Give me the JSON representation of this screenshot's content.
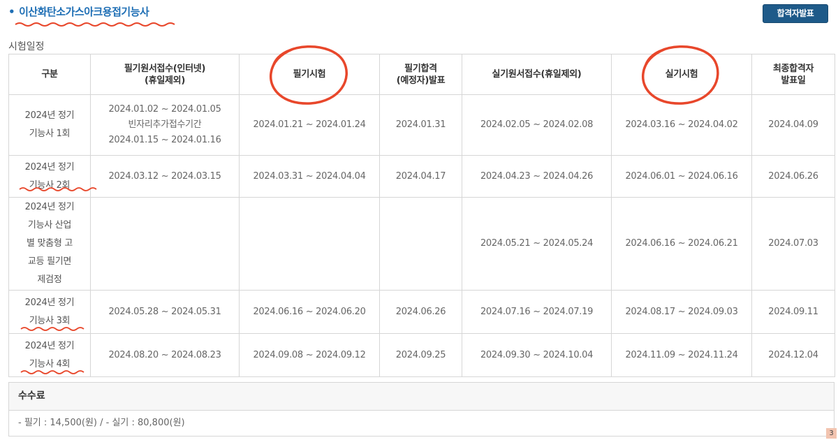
{
  "title": {
    "bullet": "•",
    "text": "이산화탄소가스아크용접기능사"
  },
  "result_button": "합격자발표",
  "section_label": "시험일정",
  "table": {
    "headers": [
      "구분",
      "필기원서접수(인터넷)\n(휴일제외)",
      "필기시험",
      "필기합격\n(예정자)발표",
      "실기원서접수(휴일제외)",
      "실기시험",
      "최종합격자\n발표일"
    ],
    "rows": [
      [
        "2024년 정기\n기능사 1회",
        "2024.01.02 ~ 2024.01.05\n빈자리추가접수기간\n2024.01.15 ~ 2024.01.16",
        "2024.01.21 ~ 2024.01.24",
        "2024.01.31",
        "2024.02.05 ~ 2024.02.08",
        "2024.03.16 ~ 2024.04.02",
        "2024.04.09"
      ],
      [
        "2024년 정기\n기능사 2회",
        "2024.03.12 ~ 2024.03.15",
        "2024.03.31 ~ 2024.04.04",
        "2024.04.17",
        "2024.04.23 ~ 2024.04.26",
        "2024.06.01 ~ 2024.06.16",
        "2024.06.26"
      ],
      [
        "2024년 정기\n기능사 산업\n별 맞춤형 고\n교등 필기면\n제검정",
        "",
        "",
        "",
        "2024.05.21 ~ 2024.05.24",
        "2024.06.16 ~ 2024.06.21",
        "2024.07.03"
      ],
      [
        "2024년 정기\n기능사 3회",
        "2024.05.28 ~ 2024.05.31",
        "2024.06.16 ~ 2024.06.20",
        "2024.06.26",
        "2024.07.16 ~ 2024.07.19",
        "2024.08.17 ~ 2024.09.03",
        "2024.09.11"
      ],
      [
        "2024년 정기\n기능사 4회",
        "2024.08.20 ~ 2024.08.23",
        "2024.09.08 ~ 2024.09.12",
        "2024.09.25",
        "2024.09.30 ~ 2024.10.04",
        "2024.11.09 ~ 2024.11.24",
        "2024.12.04"
      ]
    ]
  },
  "fee": {
    "heading": "수수료",
    "text": "- 필기 : 14,500(원) / - 실기 : 80,800(원)"
  },
  "corner_badge": "3",
  "colors": {
    "accent": "#1f6fb5",
    "button": "#1e5a89",
    "annotation": "#e8472b",
    "border": "#d6d6d6"
  }
}
